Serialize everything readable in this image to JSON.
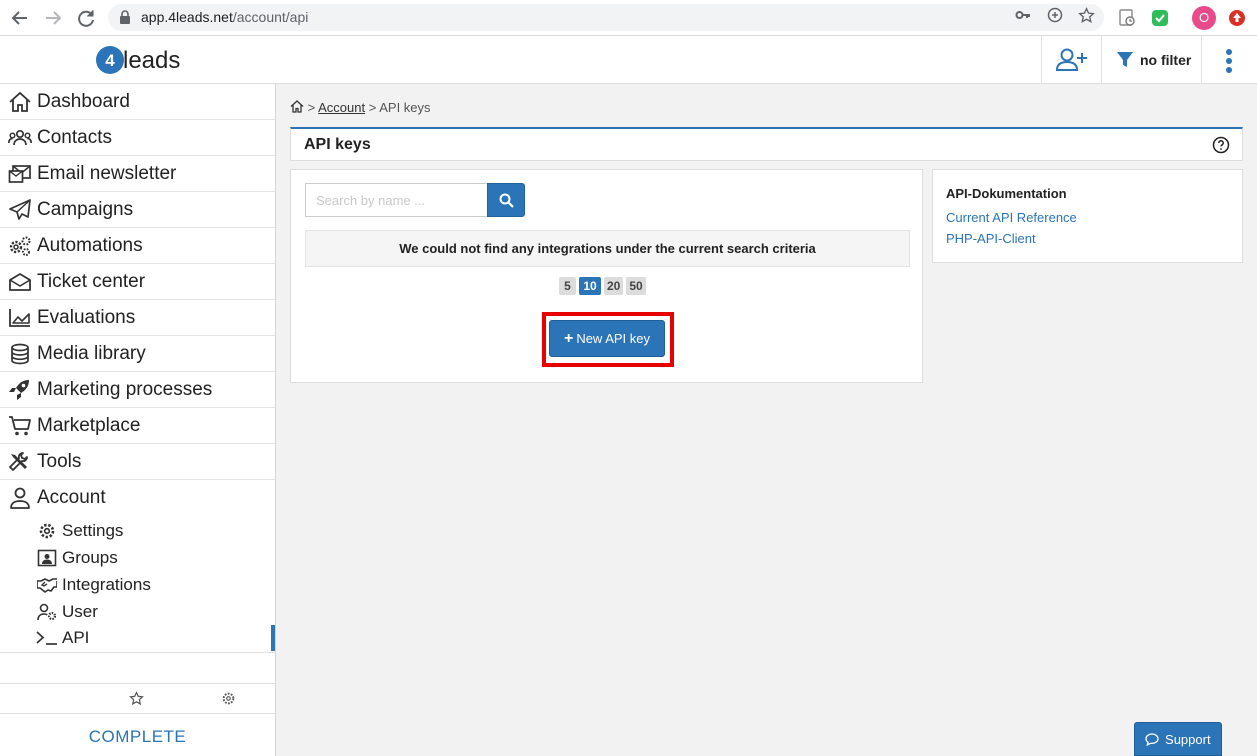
{
  "browser": {
    "url_host": "app.4leads.net",
    "url_path": "/account/api",
    "profile_initial": "O"
  },
  "header": {
    "logo_text": "4leads",
    "filter_label": "no filter"
  },
  "sidebar": {
    "items": [
      {
        "label": "Dashboard",
        "icon": "home-icon"
      },
      {
        "label": "Contacts",
        "icon": "users-icon"
      },
      {
        "label": "Email newsletter",
        "icon": "envelopes-icon"
      },
      {
        "label": "Campaigns",
        "icon": "paper-plane-icon"
      },
      {
        "label": "Automations",
        "icon": "gears-icon"
      },
      {
        "label": "Ticket center",
        "icon": "inbox-icon"
      },
      {
        "label": "Evaluations",
        "icon": "area-chart-icon"
      },
      {
        "label": "Media library",
        "icon": "database-icon"
      },
      {
        "label": "Marketing processes",
        "icon": "rocket-icon"
      },
      {
        "label": "Marketplace",
        "icon": "cart-icon"
      },
      {
        "label": "Tools",
        "icon": "tools-icon"
      },
      {
        "label": "Account",
        "icon": "user-icon"
      }
    ],
    "sub_items": [
      {
        "label": "Settings",
        "icon": "gear-icon"
      },
      {
        "label": "Groups",
        "icon": "group-icon"
      },
      {
        "label": "Integrations",
        "icon": "handshake-icon"
      },
      {
        "label": "User",
        "icon": "user-cog-icon"
      },
      {
        "label": "API",
        "icon": "terminal-icon",
        "active": true
      }
    ],
    "footer_label": "COMPLETE"
  },
  "breadcrumb": {
    "sep": ">",
    "account": "Account",
    "current": "API keys"
  },
  "page": {
    "title": "API keys",
    "search_placeholder": "Search by name ...",
    "empty_message": "We could not find any integrations under the current search criteria",
    "page_sizes": [
      "5",
      "10",
      "20",
      "50"
    ],
    "active_page_size": "10",
    "new_key_label": "New API key"
  },
  "docs": {
    "title": "API-Dokumentation",
    "links": [
      "Current API Reference",
      "PHP-API-Client"
    ]
  },
  "support_label": "Support",
  "colors": {
    "accent": "#2b74b8",
    "highlight": "#e60000"
  }
}
